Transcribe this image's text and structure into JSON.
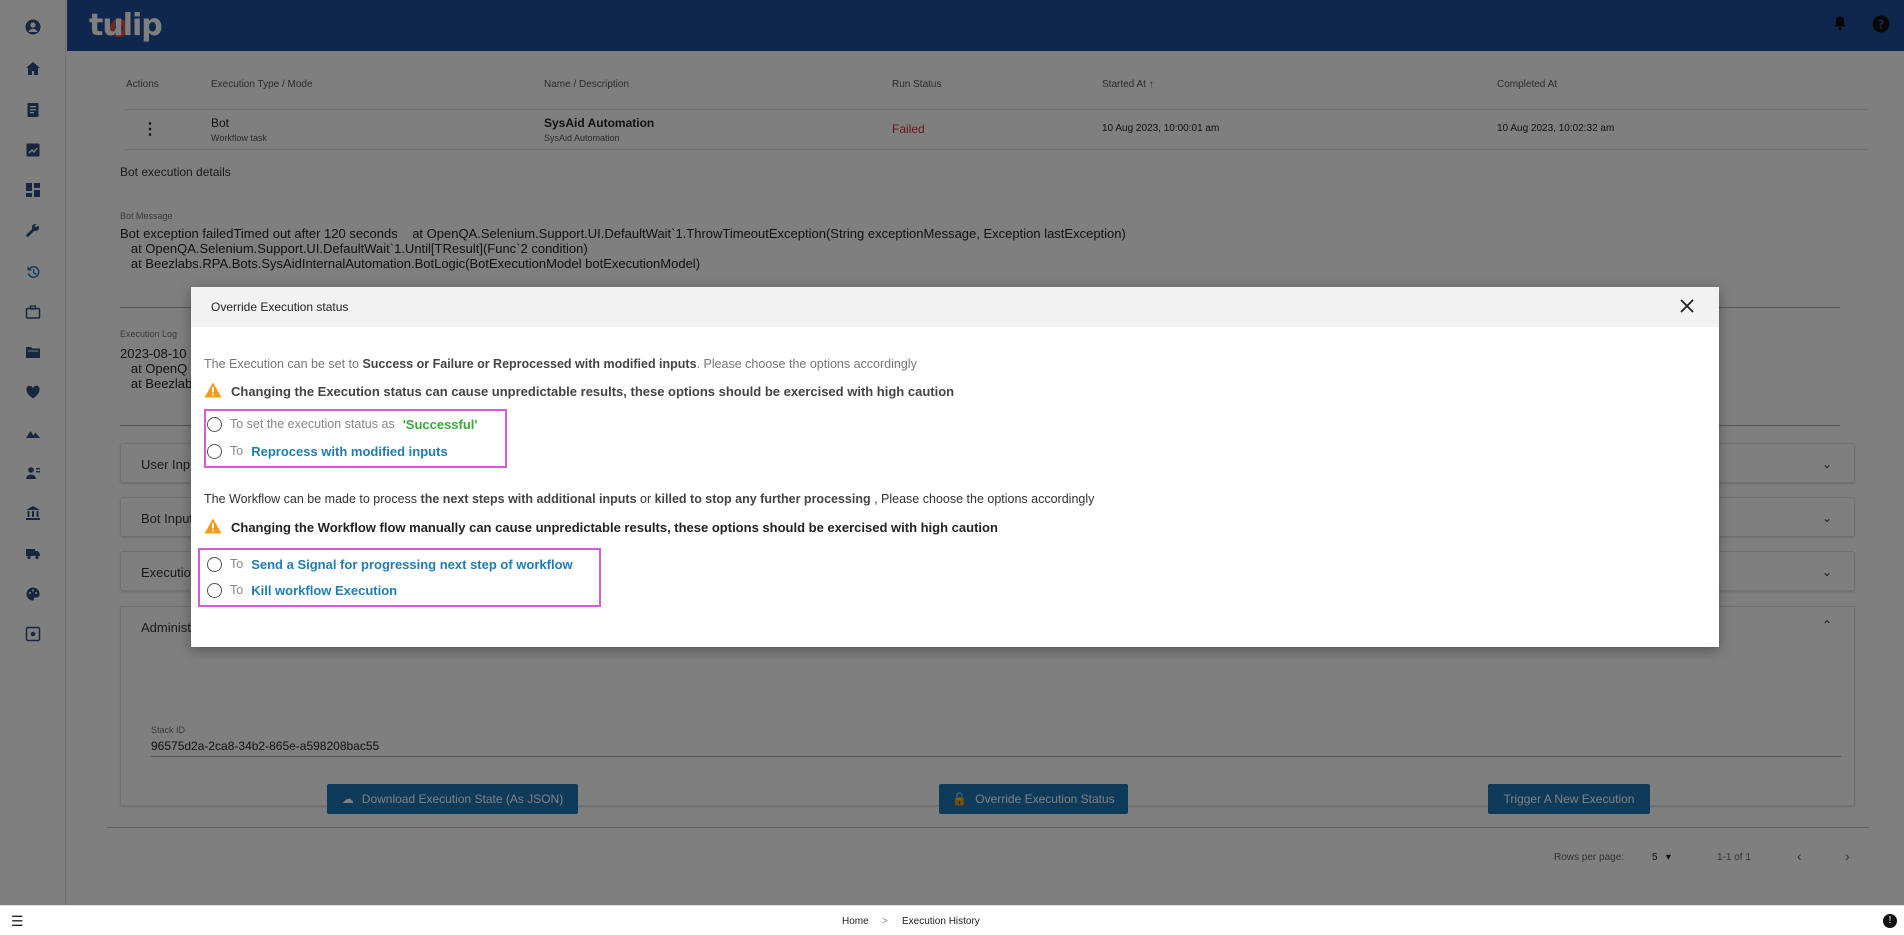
{
  "app": {
    "logo_text": "tulip"
  },
  "table": {
    "headers": [
      "Actions",
      "Execution Type / Mode",
      "Name / Description",
      "Run Status",
      "Started At",
      "Completed At"
    ],
    "row": {
      "type": "Bot",
      "mode": "Workflow task",
      "name": "SysAid Automation",
      "description": "SysAid Automation",
      "status": "Failed",
      "started": "10 Aug 2023, 10:00:01 am",
      "completed": "10 Aug 2023, 10:02:32 am"
    }
  },
  "details": {
    "title": "Bot execution details",
    "bot_message_label": "Bot Message",
    "bot_message": "Bot exception failedTimed out after 120 seconds    at OpenQA.Selenium.Support.UI.DefaultWait`1.ThrowTimeoutException(String exceptionMessage, Exception lastException)\n   at OpenQA.Selenium.Support.UI.DefaultWait`1.Until[TResult](Func`2 condition)\n   at Beezlabs.RPA.Bots.SysAidInternalAutomation.BotLogic(BotExecutionModel botExecutionModel)",
    "execution_log_label": "Execution Log",
    "execution_log": "2023-08-10\n   at OpenQ\n   at Beezlab",
    "accordions": [
      "User Inp",
      "Bot Input",
      "Executio",
      "Administ"
    ],
    "stack_id_label": "Stack ID",
    "stack_id": "96575d2a-2ca8-34b2-865e-a598208bac55",
    "buttons": {
      "download": "Download Execution State (As JSON)",
      "override": "Override Execution Status",
      "trigger": "Trigger A New Execution"
    }
  },
  "pager": {
    "rows_per_page_label": "Rows per page:",
    "rows_per_page": "5",
    "range": "1-1 of 1"
  },
  "breadcrumb": {
    "home": "Home",
    "separator": ">",
    "current": "Execution History"
  },
  "modal": {
    "title": "Override Execution status",
    "exec_intro_pre": "The Execution can be set to ",
    "exec_intro_bold": "Success or Failure or Reprocessed with modified inputs",
    "exec_intro_post": ". Please choose the options accordingly",
    "exec_warning": "Changing the Execution status can cause unpredictable results, these options should be exercised with high caution",
    "opt_success_pre": "To set the execution status as",
    "opt_success_em": "'Successful'",
    "opt_reprocess_pre": "To",
    "opt_reprocess_em": "Reprocess with modified inputs",
    "wf_intro_pre": "The Workflow can be made to process ",
    "wf_intro_bold1": "the next steps with additional inputs",
    "wf_intro_mid": " or ",
    "wf_intro_bold2": "killed to stop any further processing",
    "wf_intro_post": " , Please choose the options accordingly",
    "wf_warning": "Changing the Workflow flow manually can cause unpredictable results, these options should be exercised with high caution",
    "opt_signal_pre": "To",
    "opt_signal_em": "Send a Signal for progressing next step of workflow",
    "opt_kill_pre": "To",
    "opt_kill_em": "Kill workflow Execution"
  },
  "colors": {
    "topbar": "#1e4f9a",
    "accent": "#1f77b4",
    "failed": "#d32f2f",
    "success": "#3aa83a",
    "highlight": "#d65bd6"
  }
}
